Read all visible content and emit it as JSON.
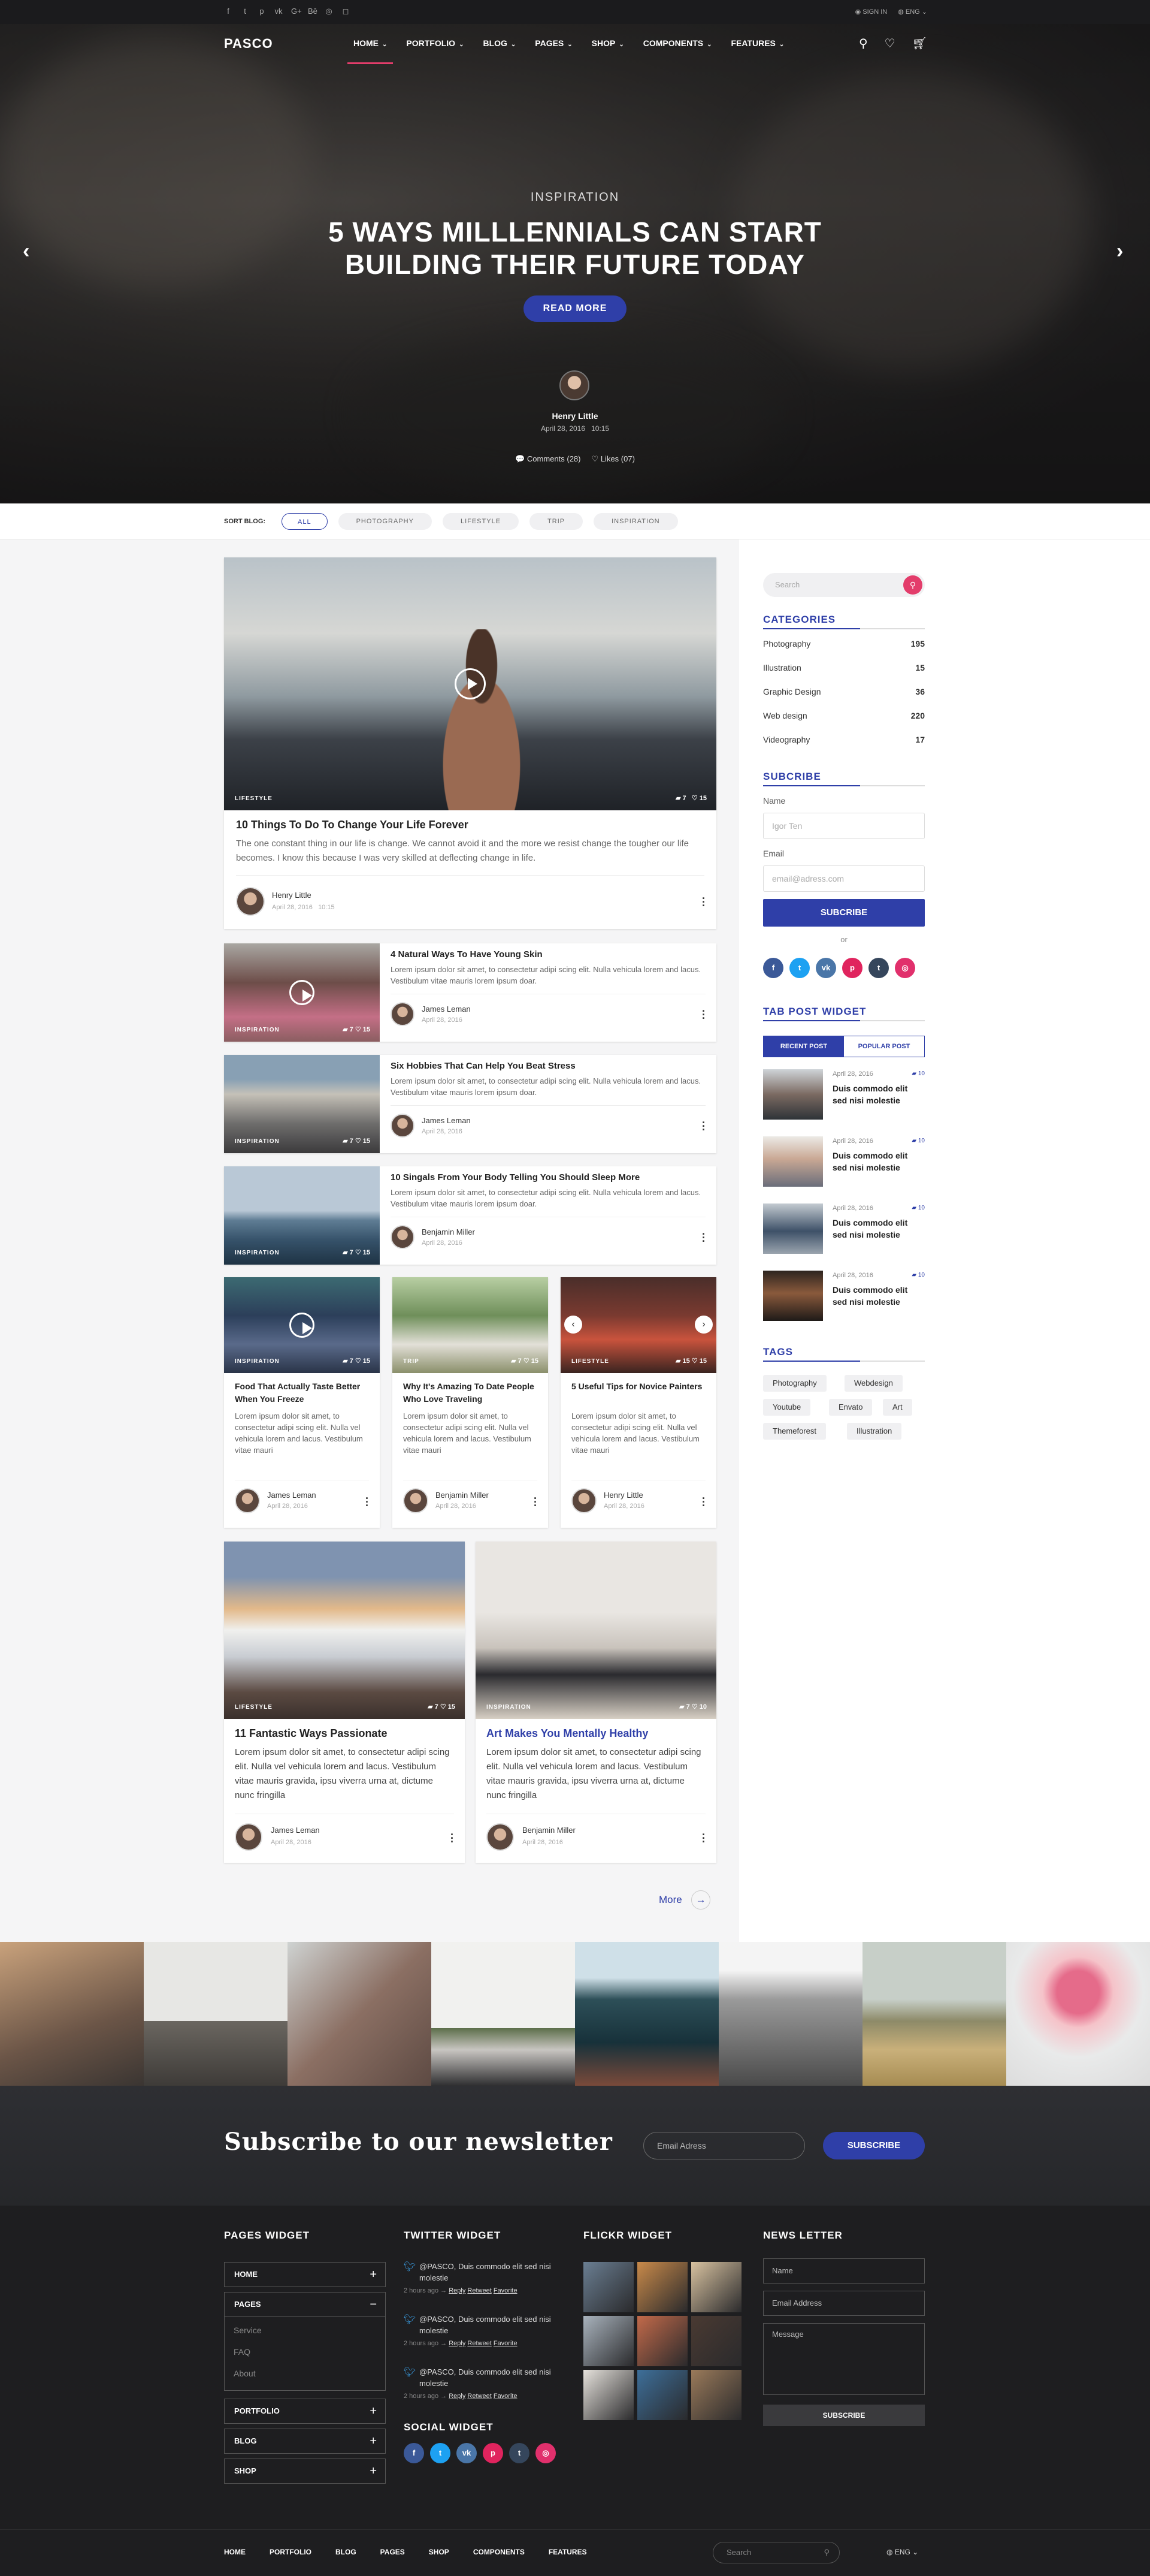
{
  "topbar": {
    "social_icons": [
      "facebook-icon",
      "twitter-icon",
      "pinterest-icon",
      "vk-icon",
      "google-plus-icon",
      "behance-icon",
      "dribbble-icon",
      "instagram-icon"
    ],
    "social_glyphs": [
      "f",
      "t",
      "p",
      "vk",
      "G+",
      "Bē",
      "◎",
      "◻"
    ],
    "sign_in": "SIGN IN",
    "lang": "ENG"
  },
  "nav": {
    "logo": "PASCO",
    "items": [
      "HOME",
      "PORTFOLIO",
      "BLOG",
      "PAGES",
      "SHOP",
      "COMPONENTS",
      "FEATURES"
    ]
  },
  "hero": {
    "category": "INSPIRATION",
    "title_line1": "5 WAYS MILLLENNIALS CAN START",
    "title_line2": "BUILDING THEIR FUTURE TODAY",
    "button": "READ MORE",
    "author": "Henry Little",
    "date": "April 28, 2016",
    "time": "10:15",
    "comments": "Comments (28)",
    "likes": "Likes (07)"
  },
  "filter": {
    "label": "SORT BLOG:",
    "options": [
      "ALL",
      "PHOTOGRAPHY",
      "LIFESTYLE",
      "TRIP",
      "INSPIRATION"
    ]
  },
  "featured": {
    "tag": "LIFESTYLE",
    "comments": "7",
    "likes": "15",
    "title": "10 Things To Do To Change Your Life Forever",
    "desc": "The one constant thing in our life is change. We cannot avoid it and the more we resist change the tougher our life becomes. I know this because I was very skilled at deflecting change in life.",
    "author": "Henry Little",
    "date": "April 28, 2016",
    "time": "10:15"
  },
  "list_posts": [
    {
      "tag": "INSPIRATION",
      "comments": "7",
      "likes": "15",
      "title": "4 Natural Ways To Have Young Skin",
      "desc": "Lorem ipsum dolor sit amet, to consectetur  adipi scing elit. Nulla vehicula lorem and lacus. Vestibulum vitae mauris lorem ipsum doar.",
      "author": "James Leman",
      "date": "April 28, 2016"
    },
    {
      "tag": "INSPIRATION",
      "comments": "7",
      "likes": "15",
      "title": "Six Hobbies That Can Help You Beat Stress",
      "desc": "Lorem ipsum dolor sit amet, to consectetur  adipi scing elit. Nulla vehicula lorem and lacus. Vestibulum vitae mauris lorem ipsum doar.",
      "author": "James Leman",
      "date": "April 28, 2016"
    },
    {
      "tag": "INSPIRATION",
      "comments": "7",
      "likes": "15",
      "title": "10 Singals From Your Body Telling You Should Sleep More",
      "desc": "Lorem ipsum dolor sit amet, to consectetur  adipi scing elit. Nulla vehicula lorem and lacus. Vestibulum vitae mauris lorem ipsum doar.",
      "author": "Benjamin Miller",
      "date": "April 28, 2016"
    }
  ],
  "three_posts": [
    {
      "tag": "INSPIRATION",
      "comments": "7",
      "likes": "15",
      "title": "Food That Actually Taste Better When You Freeze",
      "desc": "Lorem ipsum dolor sit amet, to consectetur  adipi scing elit. Nulla vel vehicula lorem and lacus. Vestibulum vitae mauri",
      "author": "James Leman",
      "date": "April 28, 2016"
    },
    {
      "tag": "TRIP",
      "comments": "7",
      "likes": "15",
      "title": "Why It's Amazing To Date People Who Love Traveling",
      "desc": "Lorem ipsum dolor sit amet, to consectetur  adipi scing elit. Nulla vel vehicula lorem and lacus. Vestibulum vitae mauri",
      "author": "Benjamin Miller",
      "date": "April 28, 2016"
    },
    {
      "tag": "LIFESTYLE",
      "comments": "15",
      "likes": "15",
      "title": "5 Useful Tips for Novice Painters",
      "desc": "Lorem ipsum dolor sit amet, to consectetur  adipi scing elit. Nulla vel vehicula lorem and lacus. Vestibulum vitae mauri",
      "author": "Henry Little",
      "date": "April 28, 2016"
    }
  ],
  "two_posts": [
    {
      "tag": "LIFESTYLE",
      "comments": "7",
      "likes": "15",
      "title": "11 Fantastic Ways Passionate",
      "desc": "Lorem ipsum dolor sit amet, to consectetur adipi scing elit. Nulla vel vehicula lorem and lacus. Vestibulum vitae mauris gravida, ipsu viverra urna at, dictume nunc fringilla",
      "author": "James Leman",
      "date": "April 28, 2016"
    },
    {
      "tag": "INSPIRATION",
      "comments": "7",
      "likes": "10",
      "title": "Art Makes You Mentally Healthy",
      "desc": "Lorem ipsum dolor sit amet, to consectetur adipi scing elit. Nulla vel vehicula lorem and lacus. Vestibulum vitae mauris gravida, ipsu viverra urna at, dictume nunc fringilla",
      "author": "Benjamin Miller",
      "date": "April 28, 2016"
    }
  ],
  "more": "More",
  "sidebar": {
    "search_placeholder": "Search",
    "categories_title": "CATEGORIES",
    "categories": [
      {
        "name": "Photography",
        "count": "195"
      },
      {
        "name": "Illustration",
        "count": "15"
      },
      {
        "name": "Graphic Design",
        "count": "36"
      },
      {
        "name": "Web design",
        "count": "220"
      },
      {
        "name": "Videography",
        "count": "17"
      }
    ],
    "subscribe_title": "SUBCRIBE",
    "name_label": "Name",
    "name_value": "Igor Ten",
    "email_label": "Email",
    "email_placeholder": "email@adress.com",
    "subscribe_button": "SUBCRIBE",
    "or": "or",
    "social_glyphs": [
      "f",
      "t",
      "vk",
      "p",
      "t",
      "◎"
    ],
    "tab_title": "TAB POST WIDGET",
    "tabs": [
      "RECENT POST",
      "POPULAR POST"
    ],
    "posts": [
      {
        "date": "April 28, 2016",
        "comments": "10",
        "title": "Duis commodo elit sed nisi molestie"
      },
      {
        "date": "April 28, 2016",
        "comments": "10",
        "title": "Duis commodo elit sed nisi molestie"
      },
      {
        "date": "April 28, 2016",
        "comments": "10",
        "title": "Duis commodo elit sed nisi molestie"
      },
      {
        "date": "April 28, 2016",
        "comments": "10",
        "title": "Duis commodo elit sed nisi molestie"
      }
    ],
    "tags_title": "TAGS",
    "tags": [
      "Photography",
      "Webdesign",
      "Youtube",
      "Envato",
      "Art",
      "Themeforest",
      "Illustration"
    ]
  },
  "newsletter": {
    "title": "Subscribe to our newsletter",
    "placeholder": "Email Adress",
    "button": "SUBSCRIBE"
  },
  "footer": {
    "pages_title": "PAGES WIDGET",
    "pages": [
      "HOME",
      "PAGES",
      "PORTFOLIO",
      "BLOG",
      "SHOP"
    ],
    "subpages": [
      "Service",
      "FAQ",
      "About"
    ],
    "twitter_title": "TWITTER WIDGET",
    "tweets": [
      {
        "text": "@PASCO, Duis commodo elit sed nisi molestie",
        "time": "2 hours ago",
        "reply": "Reply",
        "retweet": "Retweet",
        "favorite": "Favorite"
      },
      {
        "text": "@PASCO, Duis commodo elit sed nisi molestie",
        "time": "2 hours ago",
        "reply": "Reply",
        "retweet": "Retweet",
        "favorite": "Favorite"
      },
      {
        "text": "@PASCO, Duis commodo elit sed nisi molestie",
        "time": "2 hours ago",
        "reply": "Reply",
        "retweet": "Retweet",
        "favorite": "Favorite"
      }
    ],
    "social_title": "SOCIAL WIDGET",
    "flickr_title": "FLICKR WIDGET",
    "news_title": "NEWS LETTER",
    "news_name": "Name",
    "news_email": "Email Address",
    "news_message": "Message",
    "news_button": "SUBSCRIBE"
  },
  "bottom": {
    "links": [
      "HOME",
      "PORTFOLIO",
      "BLOG",
      "PAGES",
      "SHOP",
      "COMPONENTS",
      "FEATURES"
    ],
    "search": "Search",
    "lang": "ENG"
  }
}
